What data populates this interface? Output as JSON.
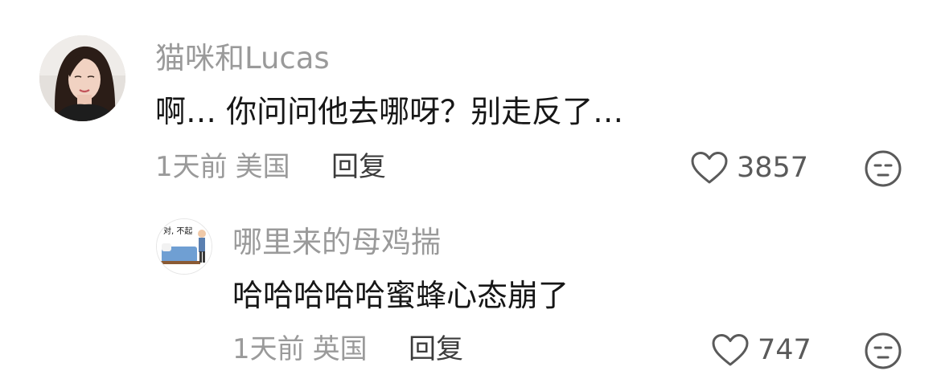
{
  "comments": [
    {
      "username": "猫咪和Lucas",
      "content": "啊… 你问问他去哪呀？别走反了…",
      "time": "1天前",
      "location": "美国",
      "reply_label": "回复",
      "like_count": "3857",
      "avatar_icon": "profile-photo-woman",
      "like_icon": "heart-outline-icon",
      "dislike_icon": "unamused-face-icon"
    },
    {
      "username": "哪里来的母鸡揣",
      "content": "哈哈哈哈哈蜜蜂心态崩了",
      "time": "1天前",
      "location": "英国",
      "reply_label": "回复",
      "like_count": "747",
      "avatar_text": "对, 不起",
      "avatar_icon": "cartoon-bed-avatar",
      "like_icon": "heart-outline-icon",
      "dislike_icon": "unamused-face-icon"
    }
  ],
  "colors": {
    "username": "#9a9a9a",
    "content": "#161616",
    "meta": "#9a9a9a",
    "reply": "#3c3c3c",
    "icon": "#5a5a5a"
  }
}
